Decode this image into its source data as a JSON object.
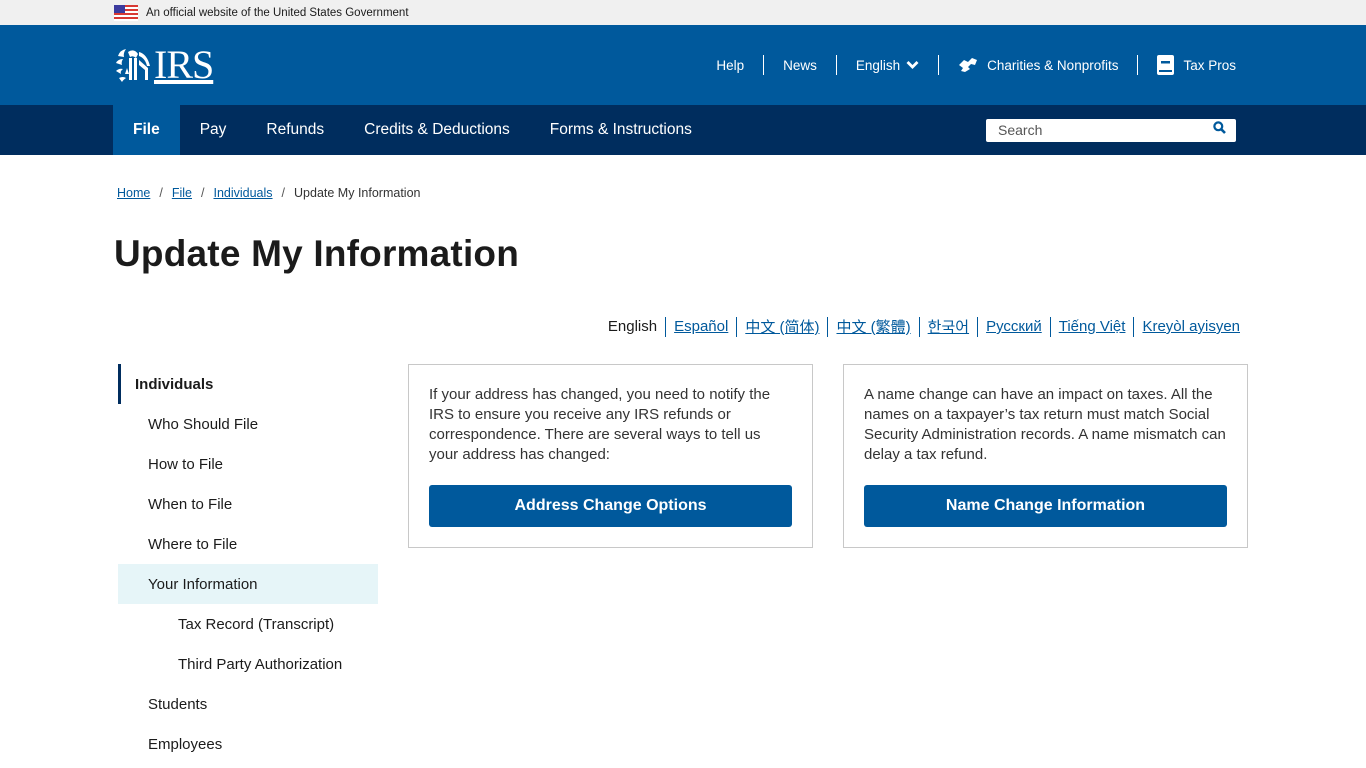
{
  "gov_banner": {
    "text": "An official website of the United States Government",
    "icon": "us-flag-icon"
  },
  "header": {
    "logo_text": "IRS",
    "utility_nav": [
      {
        "label": "Help"
      },
      {
        "label": "News"
      },
      {
        "label": "English",
        "icon": "chevron-down-icon"
      },
      {
        "label": "Charities & Nonprofits",
        "icon": "handshake-icon"
      },
      {
        "label": "Tax Pros",
        "icon": "book-icon"
      }
    ]
  },
  "main_nav": {
    "items": [
      {
        "label": "File",
        "active": true
      },
      {
        "label": "Pay"
      },
      {
        "label": "Refunds"
      },
      {
        "label": "Credits & Deductions"
      },
      {
        "label": "Forms & Instructions"
      }
    ],
    "search": {
      "placeholder": "Search",
      "value": ""
    }
  },
  "breadcrumb": {
    "items": [
      {
        "label": "Home"
      },
      {
        "label": "File"
      },
      {
        "label": "Individuals"
      }
    ],
    "current": "Update My Information"
  },
  "page": {
    "title": "Update My Information"
  },
  "languages": {
    "current": "English",
    "links": [
      "Español",
      "中文 (简体)",
      "中文 (繁體)",
      "한국어",
      "Русский",
      "Tiếng Việt",
      "Kreyòl ayisyen"
    ]
  },
  "sidebar": {
    "heading": "Individuals",
    "items": [
      {
        "label": "Who Should File"
      },
      {
        "label": "How to File"
      },
      {
        "label": "When to File"
      },
      {
        "label": "Where to File"
      },
      {
        "label": "Your Information",
        "active": true
      },
      {
        "label": "Tax Record (Transcript)",
        "sub": true
      },
      {
        "label": "Third Party Authorization",
        "sub": true
      },
      {
        "label": "Students"
      },
      {
        "label": "Employees"
      }
    ]
  },
  "cards": [
    {
      "text": "If your address has changed, you need to notify the IRS to ensure you receive any IRS refunds or correspondence. There are several ways to tell us your address has changed:",
      "button": "Address Change Options"
    },
    {
      "text": "A name change can have an impact on taxes. All the names on a taxpayer’s tax return must match Social Security Administration records. A name mismatch can delay a tax refund.",
      "button": "Name Change Information"
    }
  ],
  "colors": {
    "brand_blue": "#00599c",
    "nav_dark": "#002d5e",
    "sidebar_active_bg": "#e6f5f8"
  }
}
